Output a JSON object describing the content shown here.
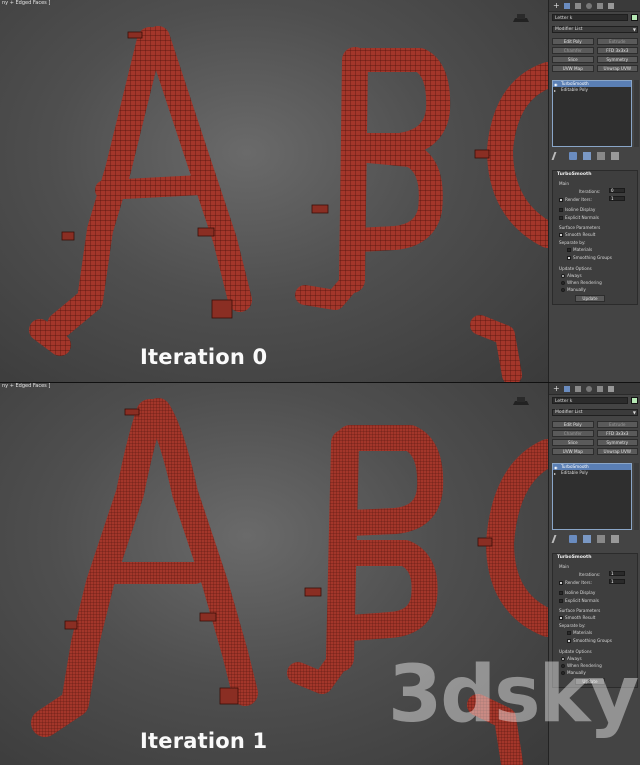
{
  "colors": {
    "viewport_bg": "#4f4f4f",
    "mesh_red": "#a3362a",
    "wire": "#3a0e08",
    "panel_bg": "#444444",
    "selection_blue": "#5a7fb5",
    "object_color": "#b5e7b4"
  },
  "top": {
    "viewport_label": "[+] [Perspective] [Realistic + Edged Faces]",
    "viewport_label_visible": "ny + Edged Faces ]",
    "iteration_label": "Iteration 0",
    "panel": {
      "object_name": "Letter k",
      "modifier_list": "Modifier List",
      "buttons": [
        "Edit Poly",
        "Extrude",
        "Chamfer",
        "FFD 3x3x3",
        "Slice",
        "Symmetry",
        "UVW Map",
        "Unwrap UVW"
      ],
      "stack": [
        "TurboSmooth",
        "Editable Poly"
      ],
      "rollout_title": "TurboSmooth",
      "main_label": "Main",
      "iterations_label": "Iterations:",
      "iterations_value": "0",
      "render_iters_label": "Render Iters:",
      "render_iters_value": "1",
      "isoline": "Isoline Display",
      "explicit_normals": "Explicit Normals",
      "surface_params": "Surface Parameters",
      "smooth_result": "Smooth Result",
      "separate_by": "Separate by:",
      "materials": "Materials",
      "smoothing_groups": "Smoothing Groups",
      "update_options": "Update Options",
      "always": "Always",
      "when_rendering": "When Rendering",
      "manually": "Manually",
      "update_btn": "Update"
    }
  },
  "bottom": {
    "viewport_label_visible": "ny + Edged Faces ]",
    "iteration_label": "Iteration 1",
    "panel": {
      "object_name": "Letter k",
      "modifier_list": "Modifier List",
      "buttons": [
        "Edit Poly",
        "Extrude",
        "Chamfer",
        "FFD 3x3x3",
        "Slice",
        "Symmetry",
        "UVW Map",
        "Unwrap UVW"
      ],
      "stack": [
        "TurboSmooth",
        "Editable Poly"
      ],
      "rollout_title": "TurboSmooth",
      "main_label": "Main",
      "iterations_label": "Iterations:",
      "iterations_value": "1",
      "render_iters_label": "Render Iters:",
      "render_iters_value": "1",
      "isoline": "Isoline Display",
      "explicit_normals": "Explicit Normals",
      "surface_params": "Surface Parameters",
      "smooth_result": "Smooth Result",
      "separate_by": "Separate by:",
      "materials": "Materials",
      "smoothing_groups": "Smoothing Groups",
      "update_options": "Update Options",
      "always": "Always",
      "when_rendering": "When Rendering",
      "manually": "Manually",
      "update_btn": "Update"
    }
  },
  "watermark": "3dsky"
}
